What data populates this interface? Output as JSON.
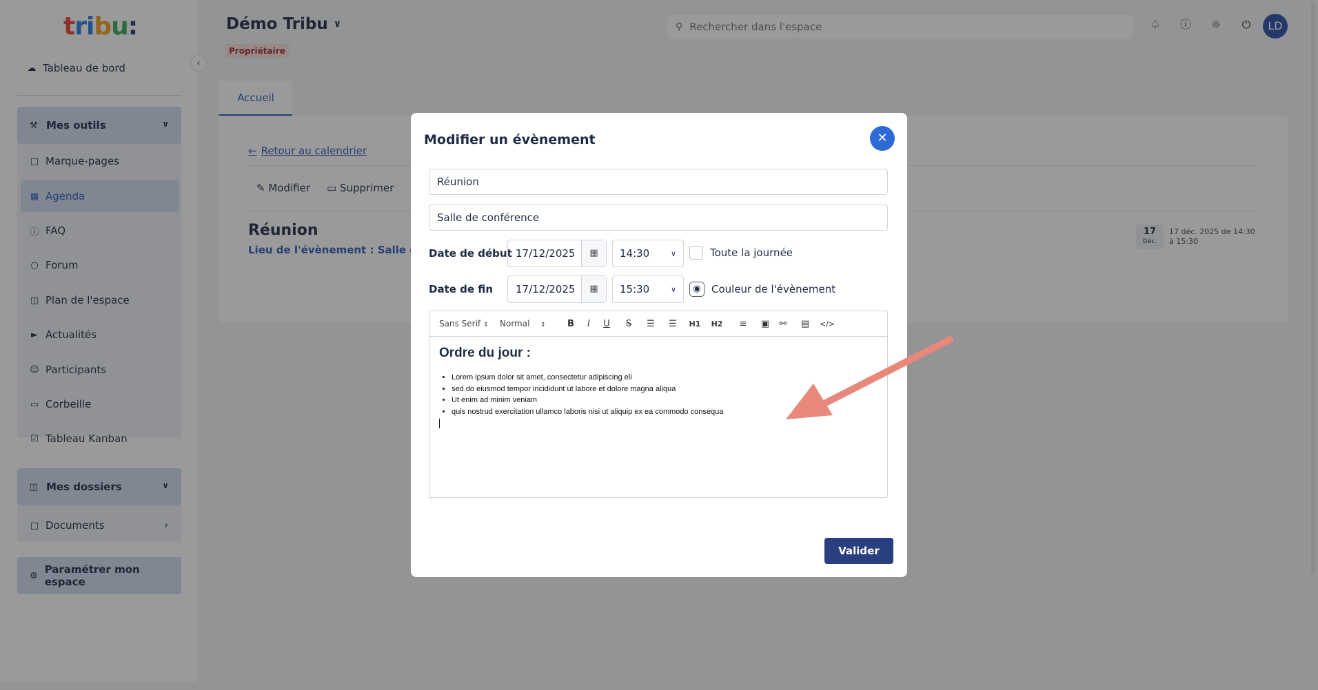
{
  "sidebar": {
    "logo": {
      "l1": "t",
      "l2": "ri",
      "l3": "b",
      "l4": "u",
      "l5": ":"
    },
    "dashboard_label": "Tableau de bord",
    "group_tools": "Mes outils",
    "items": [
      {
        "label": "Marque-pages",
        "icon": "bookmark-icon"
      },
      {
        "label": "Agenda",
        "icon": "calendar-icon"
      },
      {
        "label": "FAQ",
        "icon": "help-icon"
      },
      {
        "label": "Forum",
        "icon": "chat-icon"
      },
      {
        "label": "Plan de l'espace",
        "icon": "map-icon"
      },
      {
        "label": "Actualités",
        "icon": "megaphone-icon"
      },
      {
        "label": "Participants",
        "icon": "contact-icon"
      },
      {
        "label": "Corbeille",
        "icon": "trash-icon"
      },
      {
        "label": "Tableau Kanban",
        "icon": "checkbox-icon"
      }
    ],
    "group_folders": "Mes dossiers",
    "documents_label": "Documents",
    "settings_label": "Paramétrer mon espace"
  },
  "header": {
    "space_title": "Démo Tribu",
    "role_badge": "Propriétaire",
    "search_placeholder": "Rechercher dans l'espace",
    "avatar": "LD"
  },
  "main": {
    "tab": "Accueil",
    "back_link": "Retour au calendrier",
    "edit_label": "Modifier",
    "delete_label": "Supprimer",
    "event_title": "Réunion",
    "event_location": "Lieu de l'évènement : Salle de conférence",
    "date_day": "17",
    "date_month": "Déc.",
    "date_text": "17 déc. 2025 de 14:30 à 15:30"
  },
  "modal": {
    "title": "Modifier un évènement",
    "title_value": "Réunion",
    "location_value": "Salle de conférence",
    "start_label": "Date de début",
    "start_date": "17/12/2025",
    "start_time": "14:30",
    "all_day_label": "Toute la journée",
    "end_label": "Date de fin",
    "end_date": "17/12/2025",
    "end_time": "15:30",
    "color_label": "Couleur de l'évènement",
    "toolbar": {
      "font": "Sans Serif",
      "size": "Normal"
    },
    "content_heading": "Ordre du jour :",
    "content_items": [
      "Lorem ipsum dolor sit amet, consectetur adipiscing eli",
      "sed do eiusmod tempor incididunt ut labore et dolore magna aliqua",
      "Ut enim ad minim veniam",
      "quis nostrud exercitation ullamco laboris nisi ut aliquip ex ea commodo consequa"
    ],
    "validate_label": "Valider"
  },
  "colors": {
    "accent": "#2e6ad6",
    "primary_button": "#2a3f80",
    "arrow": "#e8887a"
  }
}
